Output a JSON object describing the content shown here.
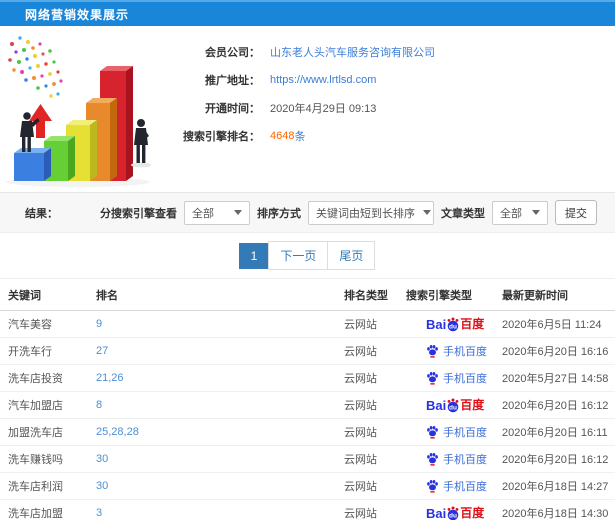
{
  "colors": {
    "accent_blue": "#1a86d9",
    "link_blue": "#3b7dd8",
    "rank_blue": "#4a90d2",
    "orange": "#ff6600",
    "baidu_blue": "#2932e1",
    "baidu_red": "#de0f17",
    "pagination_active": "#337ab7"
  },
  "header": {
    "title": "网络营销效果展示"
  },
  "clipart": {
    "name": "3d-bar-chart-growth-illustration"
  },
  "company_info": {
    "rows": [
      {
        "label": "会员公司：",
        "value": "山东老人头汽车服务咨询有限公司"
      },
      {
        "label": "推广地址：",
        "value": "https://www.lrtlsd.com"
      },
      {
        "label": "开通时间：",
        "value": "2020年4月29日 09:13"
      },
      {
        "label": "搜索引擎排名：",
        "value": "4648",
        "suffix": "条"
      }
    ]
  },
  "filter_bar": {
    "result_label": "结果：",
    "engine_filter_label": "分搜索引擎查看",
    "engine_filter_value": "全部",
    "sort_label": "排序方式",
    "sort_value": "关键词由短到长排序",
    "article_type_label": "文章类型",
    "article_type_value": "全部",
    "submit_label": "提交"
  },
  "pagination": {
    "items": [
      {
        "label": "1",
        "active": true
      },
      {
        "label": "下一页",
        "active": false
      },
      {
        "label": "尾页",
        "active": false
      }
    ]
  },
  "table": {
    "columns": [
      "关键词",
      "排名",
      "排名类型",
      "搜索引擎类型",
      "最新更新时间"
    ],
    "baidu_logo": {
      "bai": "Bai",
      "du": "du",
      "cn": "百度"
    },
    "rows": [
      {
        "keyword": "汽车美容",
        "rank": "9",
        "rank_type": "云网站",
        "engine": "百度",
        "updated": "2020年6月5日 11:24"
      },
      {
        "keyword": "开洗车行",
        "rank": "27",
        "rank_type": "云网站",
        "engine": "手机百度",
        "updated": "2020年6月20日 16:16"
      },
      {
        "keyword": "洗车店投资",
        "rank": "21,26",
        "rank_type": "云网站",
        "engine": "手机百度",
        "updated": "2020年5月27日 14:58"
      },
      {
        "keyword": "汽车加盟店",
        "rank": "8",
        "rank_type": "云网站",
        "engine": "百度",
        "updated": "2020年6月20日 16:12"
      },
      {
        "keyword": "加盟洗车店",
        "rank": "25,28,28",
        "rank_type": "云网站",
        "engine": "手机百度",
        "updated": "2020年6月20日 16:11"
      },
      {
        "keyword": "洗车赚钱吗",
        "rank": "30",
        "rank_type": "云网站",
        "engine": "手机百度",
        "updated": "2020年6月20日 16:12"
      },
      {
        "keyword": "洗车店利润",
        "rank": "30",
        "rank_type": "云网站",
        "engine": "手机百度",
        "updated": "2020年6月18日 14:27"
      },
      {
        "keyword": "洗车店加盟",
        "rank": "3",
        "rank_type": "云网站",
        "engine": "百度",
        "updated": "2020年6月18日 14:30"
      }
    ]
  }
}
